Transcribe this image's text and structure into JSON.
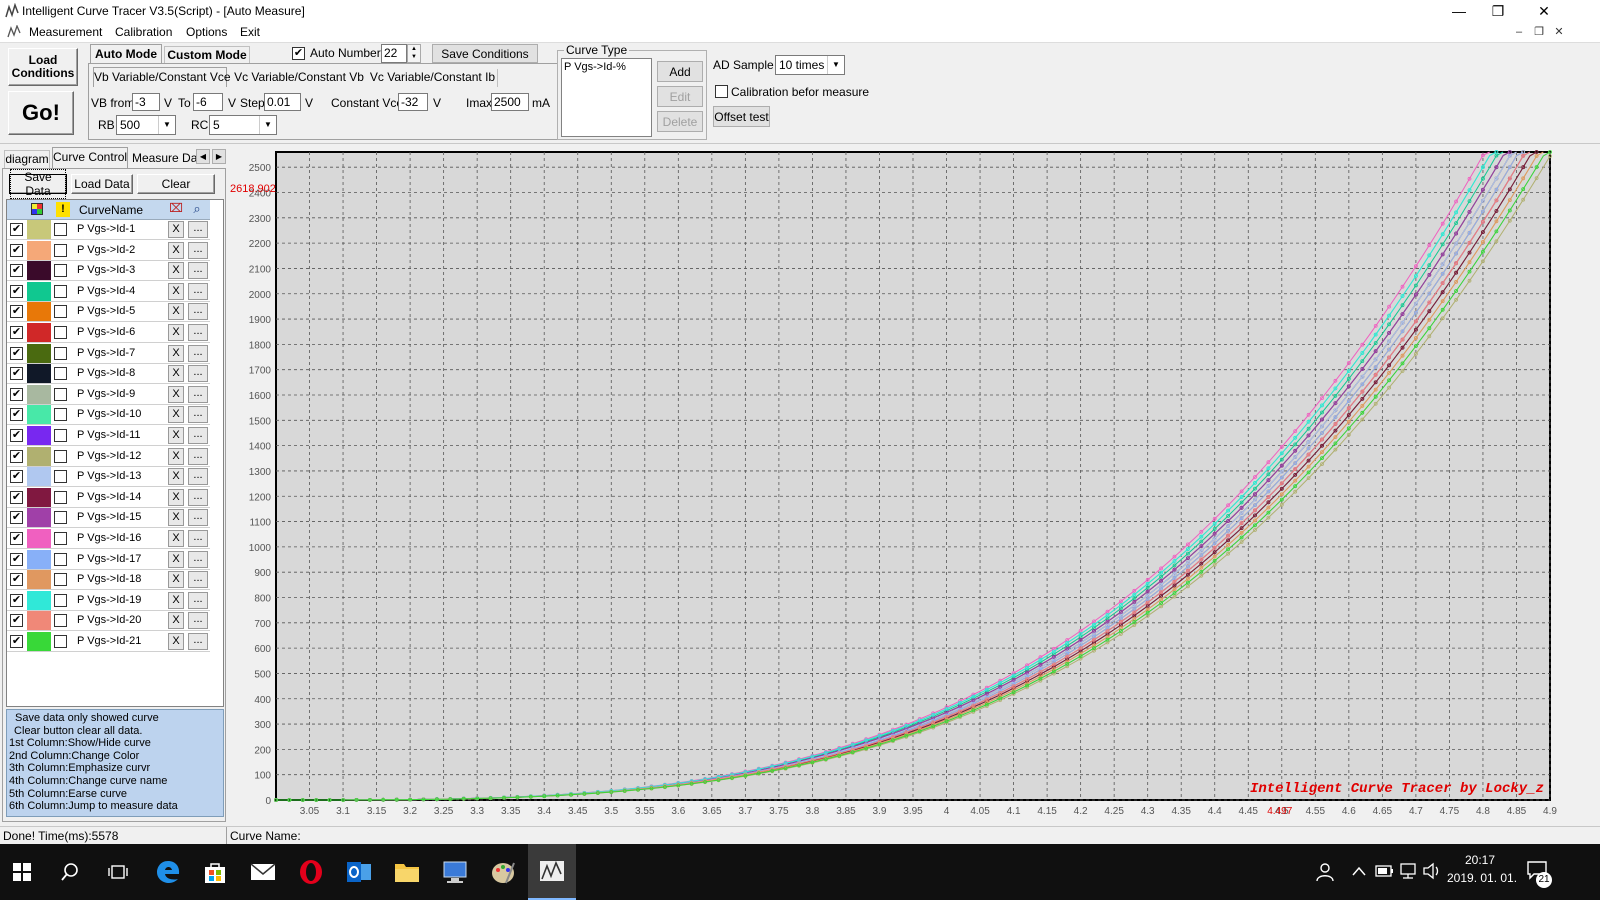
{
  "window": {
    "title": "Intelligent Curve Tracer V3.5(Script) - [Auto Measure]",
    "minimize": "—",
    "restore": "❐",
    "close": "✕"
  },
  "menu": {
    "items": [
      "Measurement",
      "Calibration",
      "Options",
      "Exit"
    ],
    "mdi_minimize": "–",
    "mdi_restore": "❐",
    "mdi_close": "✕"
  },
  "toolbar": {
    "load_conditions": [
      "Load",
      "Conditions"
    ],
    "go": "Go!",
    "mode_tabs": [
      "Auto Mode",
      "Custom Mode"
    ],
    "auto_number_label": "Auto Number",
    "auto_number_checked": "✔",
    "auto_number_value": "22",
    "save_conditions": "Save Conditions",
    "sub_tabs": [
      "Vb Variable/Constant Vce",
      "Vc Variable/Constant Vb",
      "Vc Variable/Constant Ib"
    ],
    "vb_from_label": "VB from",
    "vb_from": "-3",
    "v1": "V",
    "to_label": "To",
    "to": "-6",
    "v2": "V",
    "step_label": "Step",
    "step": "0.01",
    "v3": "V",
    "const_vce_label": "Constant Vce",
    "const_vce": "-32",
    "v4": "V",
    "imax_label": "Imax",
    "imax": "2500",
    "ma": "mA",
    "rb_label": "RB",
    "rb": "500",
    "rc_label": "RC",
    "rc": "5",
    "curve_type_label": "Curve Type",
    "curve_type_item": "P Vgs->Id-%",
    "add": "Add",
    "edit": "Edit",
    "delete": "Delete",
    "ad_sample_label": "AD Sample",
    "ad_sample": "10 times",
    "calibration_label": "Calibration befor measure",
    "offset_test": "Offset test"
  },
  "left": {
    "tabs": [
      "diagram",
      "Curve Control",
      "Measure Data"
    ],
    "save_data": "Save Data",
    "load_data": "Load Data",
    "clear": "Clear",
    "col_name": "CurveName",
    "check_mark": "✔",
    "x_label": "X",
    "more_label": "...",
    "curves": [
      {
        "name": "P Vgs->Id-1",
        "color": "#c8c87a"
      },
      {
        "name": "P Vgs->Id-2",
        "color": "#f5a878"
      },
      {
        "name": "P Vgs->Id-3",
        "color": "#3a0a2a"
      },
      {
        "name": "P Vgs->Id-4",
        "color": "#10c890"
      },
      {
        "name": "P Vgs->Id-5",
        "color": "#e87808"
      },
      {
        "name": "P Vgs->Id-6",
        "color": "#d02828"
      },
      {
        "name": "P Vgs->Id-7",
        "color": "#4a6a10"
      },
      {
        "name": "P Vgs->Id-8",
        "color": "#101828"
      },
      {
        "name": "P Vgs->Id-9",
        "color": "#a8b8a0"
      },
      {
        "name": "P Vgs->Id-10",
        "color": "#48e8a8"
      },
      {
        "name": "P Vgs->Id-11",
        "color": "#7828f0"
      },
      {
        "name": "P Vgs->Id-12",
        "color": "#b0b070"
      },
      {
        "name": "P Vgs->Id-13",
        "color": "#b0c8f0"
      },
      {
        "name": "P Vgs->Id-14",
        "color": "#801840"
      },
      {
        "name": "P Vgs->Id-15",
        "color": "#a040a8"
      },
      {
        "name": "P Vgs->Id-16",
        "color": "#f060c0"
      },
      {
        "name": "P Vgs->Id-17",
        "color": "#88b0f8"
      },
      {
        "name": "P Vgs->Id-18",
        "color": "#e09860"
      },
      {
        "name": "P Vgs->Id-19",
        "color": "#30e8d8"
      },
      {
        "name": "P Vgs->Id-20",
        "color": "#f08878"
      },
      {
        "name": "P Vgs->Id-21",
        "color": "#38d838"
      }
    ],
    "help": [
      "Save data only showed curve",
      " Clear button clear all data.",
      "1st Column:Show/Hide curve",
      "2nd Column:Change Color",
      "3th Column:Emphasize curvr",
      "4th Column:Change curve name",
      "5th Column:Earse curve",
      "6th Column:Jump to measure data"
    ]
  },
  "chart_data": {
    "type": "line",
    "x_ticks": [
      "3.05",
      "3.1",
      "3.15",
      "3.2",
      "3.25",
      "3.3",
      "3.35",
      "3.4",
      "3.45",
      "3.5",
      "3.55",
      "3.6",
      "3.65",
      "3.7",
      "3.75",
      "3.8",
      "3.85",
      "3.9",
      "3.95",
      "4",
      "4.05",
      "4.1",
      "4.15",
      "4.2",
      "4.25",
      "4.3",
      "4.35",
      "4.4",
      "4.45",
      "4.5",
      "4.55",
      "4.6",
      "4.65",
      "4.7",
      "4.75",
      "4.8",
      "4.85",
      "4.9"
    ],
    "y_ticks": [
      "0",
      "100",
      "200",
      "300",
      "400",
      "500",
      "600",
      "700",
      "800",
      "900",
      "1000",
      "1100",
      "1200",
      "1300",
      "1400",
      "1500",
      "1600",
      "1700",
      "1800",
      "1900",
      "2000",
      "2100",
      "2200",
      "2300",
      "2400",
      "2500"
    ],
    "xlim": [
      3.0,
      4.9
    ],
    "ylim": [
      0,
      2560
    ],
    "cursor_y": "2618.902",
    "cursor_x": "4.497",
    "watermark": "Intelligent Curve Tracer by Locky_z",
    "grid": true,
    "curve_model": "each curve: y = 2500 * ((x - x_start) / (x_end - x_start))^3.3, sampled 3.0..4.9, clipped at 2560",
    "curves": [
      {
        "name": "P Vgs->Id-1",
        "x_start": 3.0,
        "x_end": 4.87
      },
      {
        "name": "P Vgs->Id-2",
        "x_start": 3.0,
        "x_end": 4.84
      },
      {
        "name": "P Vgs->Id-3",
        "x_start": 3.0,
        "x_end": 4.83
      },
      {
        "name": "P Vgs->Id-4",
        "x_start": 3.0,
        "x_end": 4.81
      },
      {
        "name": "P Vgs->Id-5",
        "x_start": 3.0,
        "x_end": 4.84
      },
      {
        "name": "P Vgs->Id-6",
        "x_start": 3.0,
        "x_end": 4.85
      },
      {
        "name": "P Vgs->Id-7",
        "x_start": 3.0,
        "x_end": 4.86
      },
      {
        "name": "P Vgs->Id-8",
        "x_start": 3.0,
        "x_end": 4.82
      },
      {
        "name": "P Vgs->Id-9",
        "x_start": 3.0,
        "x_end": 4.88
      },
      {
        "name": "P Vgs->Id-10",
        "x_start": 3.0,
        "x_end": 4.8
      },
      {
        "name": "P Vgs->Id-11",
        "x_start": 3.0,
        "x_end": 4.85
      },
      {
        "name": "P Vgs->Id-12",
        "x_start": 3.0,
        "x_end": 4.89
      },
      {
        "name": "P Vgs->Id-13",
        "x_start": 3.0,
        "x_end": 4.83
      },
      {
        "name": "P Vgs->Id-14",
        "x_start": 3.0,
        "x_end": 4.86
      },
      {
        "name": "P Vgs->Id-15",
        "x_start": 3.0,
        "x_end": 4.82
      },
      {
        "name": "P Vgs->Id-16",
        "x_start": 3.0,
        "x_end": 4.79
      },
      {
        "name": "P Vgs->Id-17",
        "x_start": 3.0,
        "x_end": 4.84
      },
      {
        "name": "P Vgs->Id-18",
        "x_start": 3.0,
        "x_end": 4.87
      },
      {
        "name": "P Vgs->Id-19",
        "x_start": 3.0,
        "x_end": 4.8
      },
      {
        "name": "P Vgs->Id-20",
        "x_start": 3.0,
        "x_end": 4.85
      },
      {
        "name": "P Vgs->Id-21",
        "x_start": 3.0,
        "x_end": 4.88
      }
    ]
  },
  "status": {
    "left": "Done!  Time(ms):5578",
    "curve_name_label": "Curve Name:"
  },
  "taskbar": {
    "clock_time": "20:17",
    "clock_date": "2019. 01. 01.",
    "notif_count": "21"
  }
}
